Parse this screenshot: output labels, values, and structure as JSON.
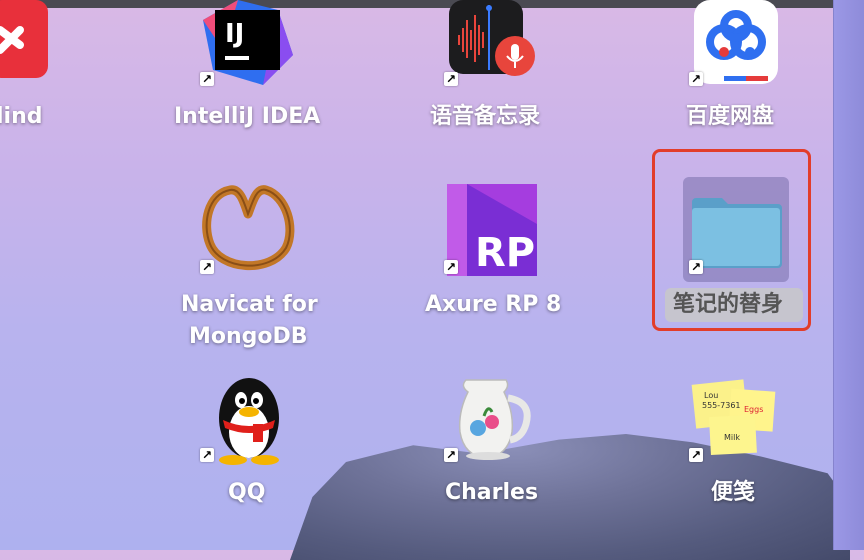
{
  "desktop": {
    "icons": [
      {
        "id": "xmind",
        "label": "lind"
      },
      {
        "id": "intellij",
        "label": "IntelliJ IDEA",
        "glyph": "IJ"
      },
      {
        "id": "voice-memos",
        "label": "语音备忘录"
      },
      {
        "id": "baidu-netdisk",
        "label": "百度网盘"
      },
      {
        "id": "navicat",
        "label_line1": "Navicat for",
        "label_line2": "MongoDB"
      },
      {
        "id": "axure",
        "label": "Axure RP 8",
        "glyph": "RP"
      },
      {
        "id": "notes-alias",
        "label": "笔记的替身"
      },
      {
        "id": "qq",
        "label": "QQ"
      },
      {
        "id": "charles",
        "label": "Charles"
      },
      {
        "id": "stickies",
        "label": "便笺"
      }
    ],
    "stickies_note": {
      "line1": "Lou",
      "line2": "555-7361",
      "line3": "Eggs",
      "line4": "Milk"
    },
    "alias_arrow": "↗"
  },
  "colors": {
    "highlight": "#e23d2a",
    "label": "#ffffff"
  }
}
